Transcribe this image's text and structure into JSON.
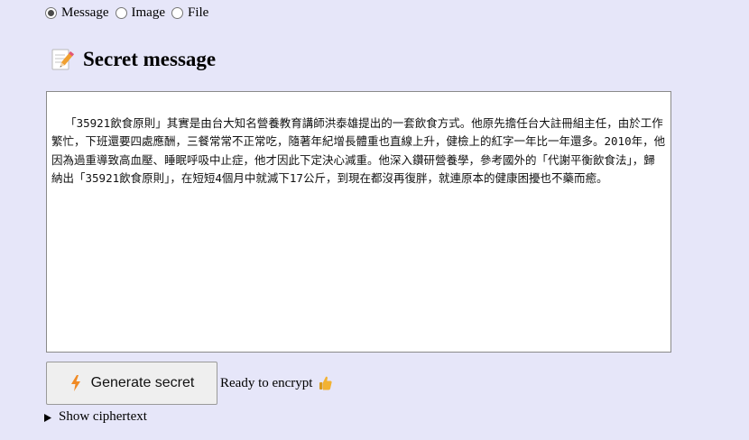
{
  "mode": {
    "options": [
      {
        "label": "Message",
        "checked": true
      },
      {
        "label": "Image",
        "checked": false
      },
      {
        "label": "File",
        "checked": false
      }
    ]
  },
  "section": {
    "title": "Secret message",
    "icon": "memo-icon"
  },
  "message": {
    "value": "「35921飲食原則」其實是由台大知名營養教育講師洪泰雄提出的一套飲食方式。他原先擔任台大註冊組主任，由於工作繁忙，下班還要四處應酬，三餐常常不正常吃，隨著年紀增長體重也直線上升，健檢上的紅字一年比一年還多。2010年，他因為過重導致高血壓、睡眠呼吸中止症，他才因此下定決心減重。他深入鑽研營養學，參考國外的「代謝平衡飲食法」，歸納出「35921飲食原則」，在短短4個月中就減下17公斤，到現在都沒再復胖，就連原本的健康困擾也不藥而癒。"
  },
  "actions": {
    "generate_label": "Generate secret",
    "generate_icon": "lightning-icon"
  },
  "status": {
    "text": "Ready to encrypt",
    "icon": "thumbs-up-icon"
  },
  "ciphertext": {
    "summary": "Show ciphertext"
  },
  "colors": {
    "background": "#e6e6f9",
    "bolt": "#f08a24",
    "thumb": "#f2b233"
  }
}
